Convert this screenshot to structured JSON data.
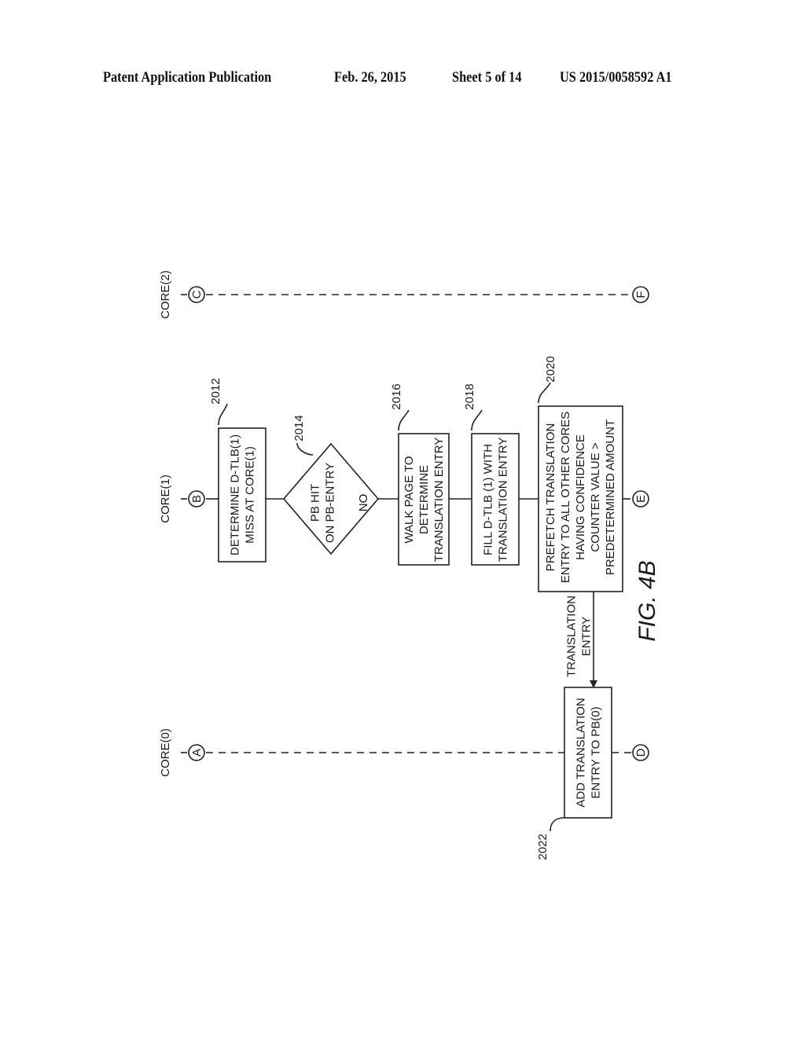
{
  "header": {
    "publication": "Patent Application Publication",
    "date": "Feb. 26, 2015",
    "sheet": "Sheet 5 of 14",
    "number": "US 2015/0058592 A1"
  },
  "figure_label": "FIG. 4B",
  "lanes": {
    "core0": {
      "label": "CORE(0)",
      "start_connector": "A",
      "end_connector": "D"
    },
    "core1": {
      "label": "CORE(1)",
      "start_connector": "B",
      "end_connector": "E"
    },
    "core2": {
      "label": "CORE(2)",
      "start_connector": "C",
      "end_connector": "F"
    }
  },
  "steps": {
    "s2012": {
      "ref": "2012",
      "lines": [
        "DETERMINE D-TLB(1)",
        "MISS AT CORE(1)"
      ]
    },
    "s2014": {
      "ref": "2014",
      "lines": [
        "PB HIT",
        "ON PB-ENTRY"
      ],
      "branch": "NO"
    },
    "s2016": {
      "ref": "2016",
      "lines": [
        "WALK PAGE TO",
        "DETERMINE",
        "TRANSLATION ENTRY"
      ]
    },
    "s2018": {
      "ref": "2018",
      "lines": [
        "FILL D-TLB (1) WITH",
        "TRANSLATION ENTRY"
      ]
    },
    "s2020": {
      "ref": "2020",
      "lines": [
        "PREFETCH TRANSLATION",
        "ENTRY TO ALL OTHER CORES",
        "HAVING CONFIDENCE",
        "COUNTER VALUE >",
        "PREDETERMINED AMOUNT"
      ]
    },
    "s2022": {
      "ref": "2022",
      "lines": [
        "ADD TRANSLATION",
        "ENTRY TO PB(0)"
      ]
    }
  },
  "arrow_label": [
    "TRANSLATION",
    "ENTRY"
  ]
}
